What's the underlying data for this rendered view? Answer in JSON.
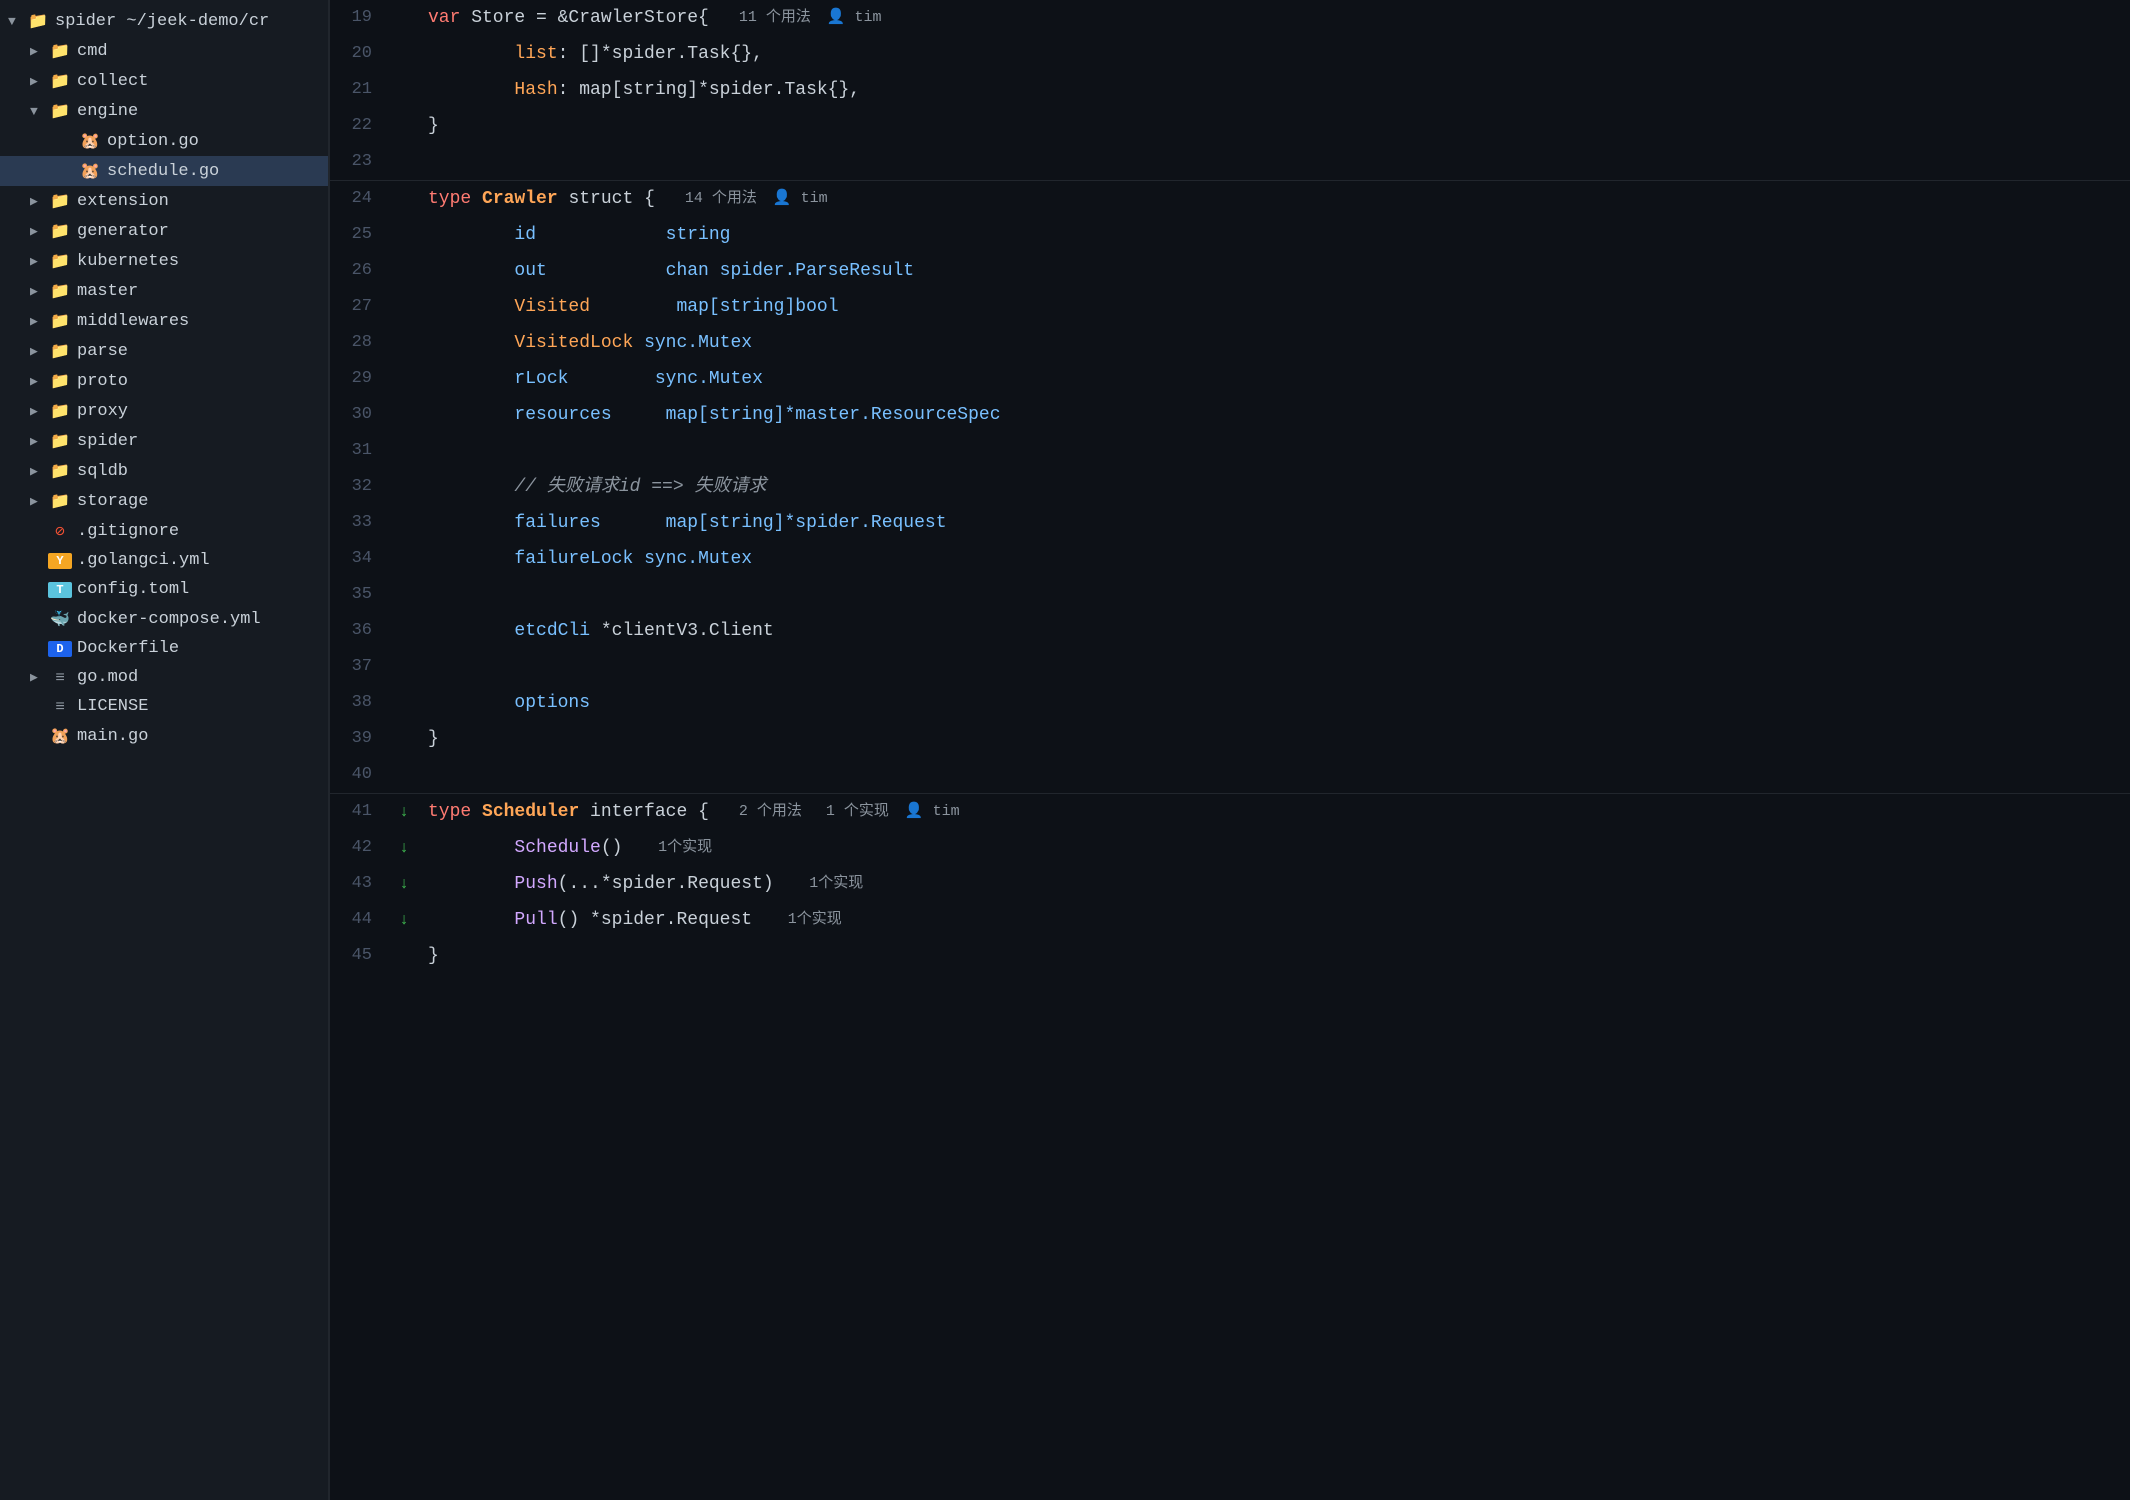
{
  "sidebar": {
    "root": {
      "label": "spider ~/jeek-demo/cr",
      "expanded": true
    },
    "items": [
      {
        "id": "cmd",
        "label": "cmd",
        "type": "folder",
        "indent": 1,
        "expanded": false
      },
      {
        "id": "collect",
        "label": "collect",
        "type": "folder",
        "indent": 1,
        "expanded": false
      },
      {
        "id": "engine",
        "label": "engine",
        "type": "folder",
        "indent": 1,
        "expanded": true
      },
      {
        "id": "option.go",
        "label": "option.go",
        "type": "go-file",
        "indent": 2,
        "expanded": false
      },
      {
        "id": "schedule.go",
        "label": "schedule.go",
        "type": "go-file",
        "indent": 2,
        "expanded": false,
        "active": true
      },
      {
        "id": "extension",
        "label": "extension",
        "type": "folder",
        "indent": 1,
        "expanded": false
      },
      {
        "id": "generator",
        "label": "generator",
        "type": "folder",
        "indent": 1,
        "expanded": false
      },
      {
        "id": "kubernetes",
        "label": "kubernetes",
        "type": "folder",
        "indent": 1,
        "expanded": false
      },
      {
        "id": "master",
        "label": "master",
        "type": "folder",
        "indent": 1,
        "expanded": false
      },
      {
        "id": "middlewares",
        "label": "middlewares",
        "type": "folder",
        "indent": 1,
        "expanded": false
      },
      {
        "id": "parse",
        "label": "parse",
        "type": "folder",
        "indent": 1,
        "expanded": false
      },
      {
        "id": "proto",
        "label": "proto",
        "type": "folder",
        "indent": 1,
        "expanded": false
      },
      {
        "id": "proxy",
        "label": "proxy",
        "type": "folder",
        "indent": 1,
        "expanded": false
      },
      {
        "id": "spider",
        "label": "spider",
        "type": "folder",
        "indent": 1,
        "expanded": false
      },
      {
        "id": "sqldb",
        "label": "sqldb",
        "type": "folder",
        "indent": 1,
        "expanded": false
      },
      {
        "id": "storage",
        "label": "storage",
        "type": "folder",
        "indent": 1,
        "expanded": false
      },
      {
        "id": ".gitignore",
        "label": ".gitignore",
        "type": "gitignore",
        "indent": 1
      },
      {
        "id": ".golangci.yml",
        "label": ".golangci.yml",
        "type": "yml",
        "indent": 1
      },
      {
        "id": "config.toml",
        "label": "config.toml",
        "type": "toml",
        "indent": 1
      },
      {
        "id": "docker-compose.yml",
        "label": "docker-compose.yml",
        "type": "docker",
        "indent": 1
      },
      {
        "id": "Dockerfile",
        "label": "Dockerfile",
        "type": "dockerfile",
        "indent": 1
      },
      {
        "id": "go.mod",
        "label": "go.mod",
        "type": "gomod",
        "indent": 1
      },
      {
        "id": "LICENSE",
        "label": "LICENSE",
        "type": "license",
        "indent": 1
      },
      {
        "id": "main.go",
        "label": "main.go",
        "type": "go-file",
        "indent": 1
      }
    ]
  },
  "editor": {
    "lines": [
      {
        "num": 19,
        "tokens": [
          {
            "t": "kw-keyword",
            "v": "var"
          },
          {
            "t": "kw-plain",
            "v": " Store = &CrawlerStore{"
          },
          {
            "t": "meta",
            "v": "11 个用法",
            "user": "tim"
          }
        ]
      },
      {
        "num": 20,
        "tokens": [
          {
            "t": "kw-plain",
            "v": "        "
          },
          {
            "t": "kw-field-orange",
            "v": "list"
          },
          {
            "t": "kw-plain",
            "v": ": []*spider.Task{},"
          }
        ]
      },
      {
        "num": 21,
        "tokens": [
          {
            "t": "kw-plain",
            "v": "        "
          },
          {
            "t": "kw-field-orange",
            "v": "Hash"
          },
          {
            "t": "kw-plain",
            "v": ": map[string]*spider.Task{},"
          }
        ]
      },
      {
        "num": 22,
        "tokens": [
          {
            "t": "kw-plain",
            "v": "}"
          }
        ]
      },
      {
        "num": 23,
        "tokens": []
      },
      {
        "num": 24,
        "separator": true,
        "tokens": [
          {
            "t": "kw-keyword",
            "v": "type"
          },
          {
            "t": "kw-plain",
            "v": " "
          },
          {
            "t": "kw-type-name",
            "v": "Crawler"
          },
          {
            "t": "kw-plain",
            "v": " struct {"
          },
          {
            "t": "meta",
            "v": "14 个用法",
            "user": "tim"
          }
        ]
      },
      {
        "num": 25,
        "tokens": [
          {
            "t": "kw-plain",
            "v": "        "
          },
          {
            "t": "kw-field",
            "v": "id"
          },
          {
            "t": "kw-plain",
            "v": "            "
          },
          {
            "t": "kw-builtin",
            "v": "string"
          }
        ]
      },
      {
        "num": 26,
        "tokens": [
          {
            "t": "kw-plain",
            "v": "        "
          },
          {
            "t": "kw-field",
            "v": "out"
          },
          {
            "t": "kw-plain",
            "v": "           "
          },
          {
            "t": "kw-builtin",
            "v": "chan spider.ParseResult"
          }
        ]
      },
      {
        "num": 27,
        "tokens": [
          {
            "t": "kw-plain",
            "v": "        "
          },
          {
            "t": "kw-field-orange",
            "v": "Visited"
          },
          {
            "t": "kw-plain",
            "v": "        "
          },
          {
            "t": "kw-builtin",
            "v": "map[string]bool"
          }
        ]
      },
      {
        "num": 28,
        "tokens": [
          {
            "t": "kw-plain",
            "v": "        "
          },
          {
            "t": "kw-field-orange",
            "v": "VisitedLock"
          },
          {
            "t": "kw-plain",
            "v": " "
          },
          {
            "t": "kw-builtin",
            "v": "sync.Mutex"
          }
        ]
      },
      {
        "num": 29,
        "tokens": [
          {
            "t": "kw-plain",
            "v": "        "
          },
          {
            "t": "kw-field",
            "v": "rLock"
          },
          {
            "t": "kw-plain",
            "v": "        "
          },
          {
            "t": "kw-builtin",
            "v": "sync.Mutex"
          }
        ]
      },
      {
        "num": 30,
        "tokens": [
          {
            "t": "kw-plain",
            "v": "        "
          },
          {
            "t": "kw-field",
            "v": "resources"
          },
          {
            "t": "kw-plain",
            "v": "     "
          },
          {
            "t": "kw-builtin",
            "v": "map[string]*master.ResourceSpec"
          }
        ]
      },
      {
        "num": 31,
        "tokens": []
      },
      {
        "num": 32,
        "tokens": [
          {
            "t": "kw-plain",
            "v": "        "
          },
          {
            "t": "kw-comment",
            "v": "// 失败请求id ==> 失败请求"
          }
        ]
      },
      {
        "num": 33,
        "tokens": [
          {
            "t": "kw-plain",
            "v": "        "
          },
          {
            "t": "kw-field",
            "v": "failures"
          },
          {
            "t": "kw-plain",
            "v": "      "
          },
          {
            "t": "kw-builtin",
            "v": "map[string]*spider.Request"
          }
        ]
      },
      {
        "num": 34,
        "tokens": [
          {
            "t": "kw-plain",
            "v": "        "
          },
          {
            "t": "kw-field",
            "v": "failureLock"
          },
          {
            "t": "kw-plain",
            "v": " "
          },
          {
            "t": "kw-builtin",
            "v": "sync.Mutex"
          }
        ]
      },
      {
        "num": 35,
        "tokens": []
      },
      {
        "num": 36,
        "tokens": [
          {
            "t": "kw-plain",
            "v": "        "
          },
          {
            "t": "kw-field",
            "v": "etcdCli"
          },
          {
            "t": "kw-plain",
            "v": " *clientV3.Client"
          }
        ]
      },
      {
        "num": 37,
        "tokens": []
      },
      {
        "num": 38,
        "tokens": [
          {
            "t": "kw-plain",
            "v": "        "
          },
          {
            "t": "kw-field",
            "v": "options"
          }
        ]
      },
      {
        "num": 39,
        "tokens": [
          {
            "t": "kw-plain",
            "v": "}"
          }
        ]
      },
      {
        "num": 40,
        "tokens": []
      },
      {
        "num": 41,
        "separator": true,
        "gutter": true,
        "tokens": [
          {
            "t": "kw-keyword",
            "v": "type"
          },
          {
            "t": "kw-plain",
            "v": " "
          },
          {
            "t": "kw-type-name",
            "v": "Scheduler"
          },
          {
            "t": "kw-plain",
            "v": " interface {"
          },
          {
            "t": "meta",
            "v": "2 个用法",
            "extra": "1 个实现",
            "user": "tim"
          }
        ]
      },
      {
        "num": 42,
        "gutter": true,
        "tokens": [
          {
            "t": "kw-plain",
            "v": "        "
          },
          {
            "t": "kw-func",
            "v": "Schedule"
          },
          {
            "t": "kw-plain",
            "v": "()  "
          },
          {
            "t": "kw-meta",
            "v": "1个实现"
          }
        ]
      },
      {
        "num": 43,
        "gutter": true,
        "tokens": [
          {
            "t": "kw-plain",
            "v": "        "
          },
          {
            "t": "kw-func",
            "v": "Push"
          },
          {
            "t": "kw-plain",
            "v": "(...*spider.Request)  "
          },
          {
            "t": "kw-meta",
            "v": "1个实现"
          }
        ]
      },
      {
        "num": 44,
        "gutter": true,
        "tokens": [
          {
            "t": "kw-plain",
            "v": "        "
          },
          {
            "t": "kw-func",
            "v": "Pull"
          },
          {
            "t": "kw-plain",
            "v": "() *spider.Request  "
          },
          {
            "t": "kw-meta",
            "v": "1个实现"
          }
        ]
      },
      {
        "num": 45,
        "tokens": [
          {
            "t": "kw-plain",
            "v": "}"
          }
        ]
      }
    ]
  }
}
